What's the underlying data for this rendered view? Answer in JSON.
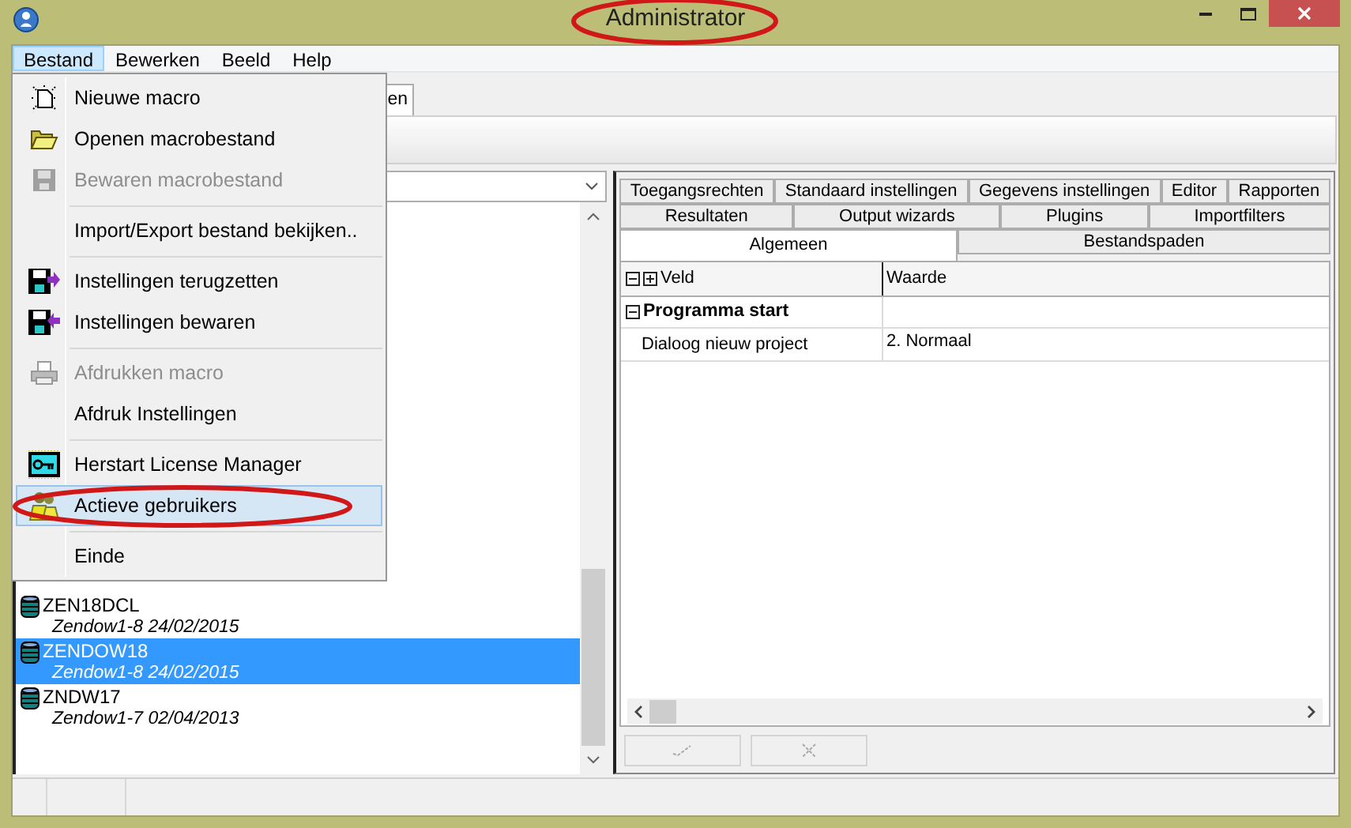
{
  "window": {
    "title": "Administrator"
  },
  "menubar": [
    {
      "label": "Bestand",
      "selected": true
    },
    {
      "label": "Bewerken",
      "selected": false
    },
    {
      "label": "Beeld",
      "selected": false
    },
    {
      "label": "Help",
      "selected": false
    }
  ],
  "file_menu": {
    "groups": [
      [
        {
          "label": "Nieuwe macro",
          "kind": "new",
          "disabled": false,
          "selected": false
        },
        {
          "label": "Openen macrobestand",
          "kind": "open",
          "disabled": false,
          "selected": false
        },
        {
          "label": "Bewaren macrobestand",
          "kind": "save",
          "disabled": true,
          "selected": false
        }
      ],
      [
        {
          "label": "Import/Export bestand bekijken..",
          "kind": "plain",
          "disabled": false,
          "selected": false
        }
      ],
      [
        {
          "label": "Instellingen terugzetten",
          "kind": "restore",
          "disabled": false,
          "selected": false
        },
        {
          "label": "Instellingen bewaren",
          "kind": "store",
          "disabled": false,
          "selected": false
        }
      ],
      [
        {
          "label": "Afdrukken macro",
          "kind": "print",
          "disabled": true,
          "selected": false
        },
        {
          "label": "Afdruk Instellingen",
          "kind": "plain",
          "disabled": false,
          "selected": false
        }
      ],
      [
        {
          "label": "Herstart License Manager",
          "kind": "key",
          "disabled": false,
          "selected": false
        },
        {
          "label": "Actieve gebruikers",
          "kind": "users",
          "disabled": false,
          "selected": true
        }
      ],
      [
        {
          "label": "Einde",
          "kind": "plain",
          "disabled": false,
          "selected": false
        }
      ]
    ]
  },
  "back_tab": {
    "label": "en"
  },
  "project_list": [
    {
      "name": "ZEN18DCL",
      "detail": "Zendow1-8 24/02/2015",
      "selected": false
    },
    {
      "name": "ZENDOW18",
      "detail": "Zendow1-8 24/02/2015",
      "selected": true
    },
    {
      "name": "ZNDW17",
      "detail": "Zendow1-7 02/04/2013",
      "selected": false
    }
  ],
  "settings_tabs": [
    [
      {
        "label": "Toegangsrechten",
        "selected": false
      },
      {
        "label": "Standaard instellingen",
        "selected": false
      },
      {
        "label": "Gegevens instellingen",
        "selected": false
      },
      {
        "label": "Editor",
        "selected": false
      },
      {
        "label": "Rapporten",
        "selected": false
      }
    ],
    [
      {
        "label": "Resultaten",
        "selected": false
      },
      {
        "label": "Output wizards",
        "selected": false
      },
      {
        "label": "Plugins",
        "selected": false
      },
      {
        "label": "Importfilters",
        "selected": false
      }
    ],
    [
      {
        "label": "Algemeen",
        "selected": true
      },
      {
        "label": "Bestandspaden",
        "selected": false
      }
    ]
  ],
  "grid": {
    "columns": [
      "Veld",
      "Waarde"
    ],
    "rows": [
      {
        "kind": "group",
        "label": "Programma start",
        "expanded": true
      },
      {
        "kind": "field",
        "label": "Dialoog nieuw project",
        "value": "2. Normaal"
      }
    ]
  },
  "action_buttons": [
    {
      "kind": "apply",
      "disabled": true
    },
    {
      "kind": "cancel",
      "disabled": true
    }
  ]
}
